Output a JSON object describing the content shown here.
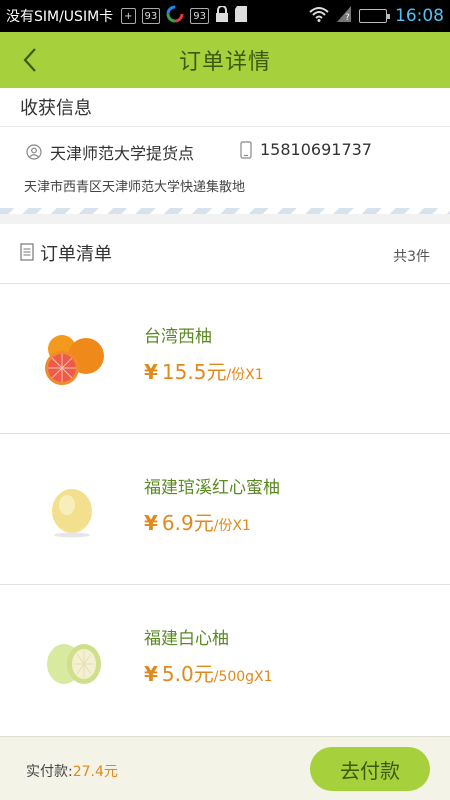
{
  "statusbar": {
    "carrier": "没有SIM/USIM卡",
    "badge1": "93",
    "badge2": "93",
    "time": "16:08"
  },
  "header": {
    "title": "订单详情"
  },
  "address": {
    "section_title": "收获信息",
    "pickup_point": "天津师范大学提货点",
    "phone": "15810691737",
    "full_address": "天津市西青区天津师范大学快递集散地"
  },
  "orders": {
    "section_title": "订单清单",
    "count_text": "共3件",
    "items": [
      {
        "name": "台湾西柚",
        "yen": "¥",
        "price": "15.5元",
        "unit": "/份X1"
      },
      {
        "name": "福建琯溪红心蜜柚",
        "yen": "¥",
        "price": "6.9元",
        "unit": "/份X1"
      },
      {
        "name": "福建白心柚",
        "yen": "¥",
        "price": "5.0元",
        "unit": "/500gX1"
      }
    ]
  },
  "footer": {
    "paid_label": "实付款:",
    "paid_amount": "27.4元",
    "pay_button": "去付款"
  },
  "colors": {
    "header_bg": "#a6d13d",
    "title_text": "#3d5a10",
    "item_name": "#5b8a23",
    "price": "#e08a1c"
  },
  "icons": [
    "back-arrow-icon",
    "user-icon",
    "phone-icon",
    "list-icon",
    "grapefruit-image",
    "pomelo-image",
    "white-pomelo-image"
  ]
}
